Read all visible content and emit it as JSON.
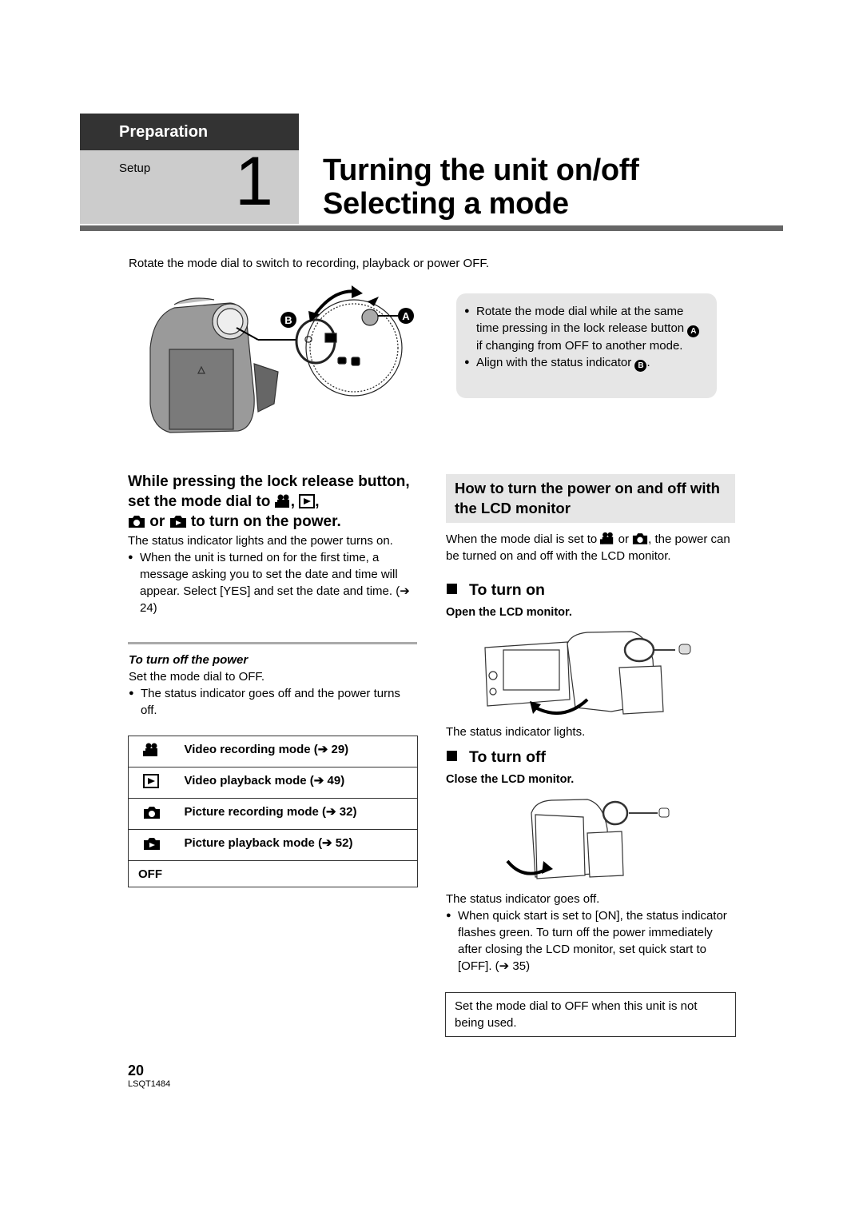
{
  "header": {
    "section": "Preparation",
    "subsection": "Setup",
    "chapter_number": "1",
    "title_line1": "Turning the unit on/off",
    "title_line2": "Selecting a mode"
  },
  "intro": "Rotate the mode dial to switch to recording, playback or power OFF.",
  "illustration_labels": {
    "a": "A",
    "b": "B"
  },
  "note_box": {
    "bullet1_pre": "Rotate the mode dial while at the same time pressing in the lock release button",
    "bullet1_badge": "A",
    "bullet1_post": "if changing from OFF to another mode.",
    "bullet2_pre": "Align with the status indicator",
    "bullet2_badge": "B",
    "bullet2_post": "."
  },
  "left": {
    "heading_part1": "While pressing the lock release button, set the mode dial to",
    "heading_sep1": ",",
    "heading_sep2": ",",
    "heading_or": "or",
    "heading_part2": "to turn on the power.",
    "body": "The status indicator lights and the power turns on.",
    "bullet": "When the unit is turned on for the first time, a message asking you to set the date and time will appear. Select [YES] and set the date and time. (➔ 24)",
    "turn_off_title": "To turn off the power",
    "turn_off_body": "Set the mode dial to OFF.",
    "turn_off_bullet": "The status indicator goes off and the power turns off."
  },
  "modes": [
    {
      "icon": "video-camera-icon",
      "label": "Video recording mode (➔ 29)"
    },
    {
      "icon": "video-playback-icon",
      "label": "Video playback mode (➔ 49)"
    },
    {
      "icon": "photo-camera-icon",
      "label": "Picture recording mode (➔ 32)"
    },
    {
      "icon": "picture-playback-icon",
      "label": "Picture playback mode (➔ 52)"
    },
    {
      "icon": "",
      "label": "OFF"
    }
  ],
  "right": {
    "heading": "How to turn the power on and off with the LCD monitor",
    "intro_pre": "When the mode dial is set to",
    "intro_or": "or",
    "intro_post": ", the power can be turned on and off with the LCD monitor.",
    "turn_on_title": "To turn on",
    "turn_on_step": "Open the LCD monitor.",
    "turn_on_result": "The status indicator lights.",
    "turn_off_title": "To turn off",
    "turn_off_step": "Close the LCD monitor.",
    "turn_off_result": "The status indicator goes off.",
    "turn_off_bullet": "When quick start is set to [ON], the status indicator flashes green. To turn off the power immediately after closing the LCD monitor, set quick start to [OFF]. (➔ 35)",
    "tip": "Set the mode dial to OFF when this unit is not being used."
  },
  "footer": {
    "page_number": "20",
    "doc_code": "LSQT1484"
  }
}
